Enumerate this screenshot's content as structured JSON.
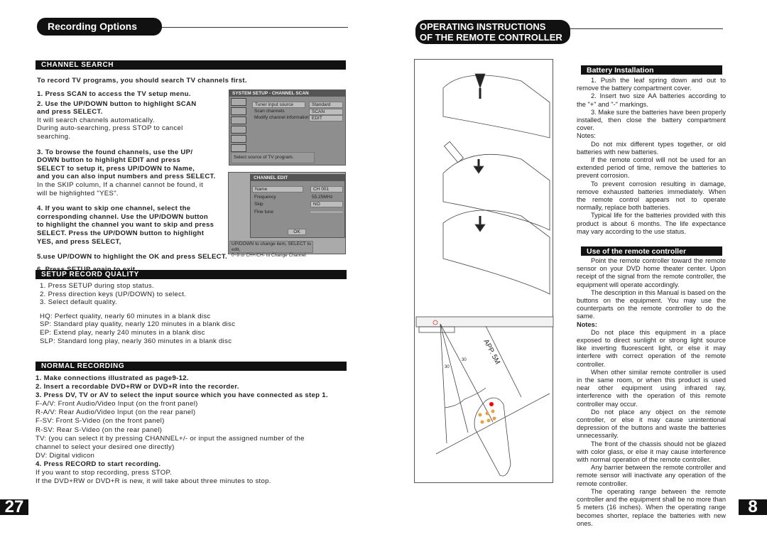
{
  "left": {
    "header": "Recording Options",
    "page_number": "27",
    "channel_search": {
      "title": "CHANNEL SEARCH",
      "intro": "To record TV programs, you should search TV channels first.",
      "lines": [
        {
          "text": "1. Press SCAN to access the TV setup menu.",
          "bold": true
        },
        {
          "text": "2. Use the UP/DOWN button to highlight SCAN",
          "bold": true
        },
        {
          "text": "and press SELECT.",
          "bold": true
        },
        {
          "text": "It will search channels automatically.",
          "bold": false
        },
        {
          "text": "During auto-searching, press STOP to cancel",
          "bold": false
        },
        {
          "text": "searching.",
          "bold": false
        },
        {
          "text": "3. To browse the found channels, use the UP/",
          "bold": true
        },
        {
          "text": "DOWN  button to highlight EDIT and press",
          "bold": true
        },
        {
          "text": "SELECT to setup it, press UP/DOWN to Name,",
          "bold": true
        },
        {
          "text": "and you can also input numbers and press SELECT.",
          "bold": true
        },
        {
          "text": "In the SKIP column, If a channel cannot be found, it",
          "bold": false
        },
        {
          "text": "will be highlighted \"YES\".",
          "bold": false
        },
        {
          "text": "4. If you want to skip one channel, select the",
          "bold": true
        },
        {
          "text": "corresponding channel.  Use the  UP/DOWN button",
          "bold": true
        },
        {
          "text": "to highlight the channel you want to skip and press",
          "bold": true
        },
        {
          "text": "SELECT. Press the UP/DOWN  button to highlight",
          "bold": true
        },
        {
          "text": "YES, and press SELECT,",
          "bold": true
        },
        {
          "text": "5.use UP/DOWN to highlight the OK and press SELECT.",
          "bold": true
        },
        {
          "text": "6. Press SETUP again to exit.",
          "bold": true
        }
      ],
      "scan_screen": {
        "title": "SYSTEM SETUP - CHANNEL SCAN",
        "rows": [
          {
            "label": "Tuner input source",
            "value": "Standard"
          },
          {
            "label": "Scan channels",
            "value": "SCAN"
          },
          {
            "label": "Modify channel information",
            "value": "EDIT"
          }
        ],
        "hint": "Select source of TV program."
      },
      "edit_screen": {
        "title": "CHANNEL EDIT",
        "name_label": "Name",
        "name_value": "CH 001",
        "freq_label": "Frequency",
        "freq_value": "55.25MHz",
        "skip_label": "Skip",
        "skip_value": "NO",
        "fine_label": "Fine tune",
        "ok": "OK",
        "hint1": "UP/DOWN to change item, SELECT to edit,",
        "hint2": "0~9 or CH+/CH- to Change Channel"
      }
    },
    "record_quality": {
      "title": "SETUP RECORD QUALITY",
      "lines": [
        "1. Press SETUP during stop status.",
        "2. Press direction keys (UP/DOWN) to select.",
        "3. Select default quality."
      ],
      "modes": [
        "HQ: Perfect quality, nearly 60 minutes in a blank disc",
        "SP: Standard play quality, nearly 120 minutes in a blank disc",
        "EP: Extend play, nearly 240 minutes in a blank disc",
        "SLP: Standard long play, nearly 360 minutes in a blank disc"
      ]
    },
    "normal_recording": {
      "title": "NORMAL RECORDING",
      "lines": [
        {
          "text": "1. Make connections illustrated as page9-12.",
          "bold": true
        },
        {
          "text": "2. Insert a recordable DVD+RW or DVD+R into the recorder.",
          "bold": true
        },
        {
          "text": "3. Press DV, TV or AV  to select the input source which you have connected as step 1.",
          "bold": true
        },
        {
          "text": "F-A/V: Front Audio/Video Input (on the front panel)",
          "bold": false
        },
        {
          "text": "R-A/V: Rear Audio/Video Input (on the rear panel)",
          "bold": false
        },
        {
          "text": "F-SV: Front S-Video (on the front panel)",
          "bold": false
        },
        {
          "text": "R-SV: Rear S-Video (on the rear panel)",
          "bold": false
        },
        {
          "text": "TV: (you can select it by pressing CHANNEL+/- or input the assigned number of the",
          "bold": false
        },
        {
          "text": "channel to select your desired one directly)",
          "bold": false
        },
        {
          "text": "DV: Digital vidicon",
          "bold": false
        },
        {
          "text": "4. Press RECORD to start recording.",
          "bold": true
        },
        {
          "text": "If you want to stop recording, press STOP.",
          "bold": false
        },
        {
          "text": "If the DVD+RW or DVD+R is new, it will take about three minutes to stop.",
          "bold": false
        }
      ]
    }
  },
  "right": {
    "header_line1": "OPERATING INSTRUCTIONS",
    "header_line2": "OF THE REMOTE CONTROLLER",
    "page_number": "8",
    "illustration": {
      "range_label": "APP. 5M",
      "angle1": "30",
      "angle2": "30"
    },
    "battery": {
      "title": "Battery Installation",
      "paras": [
        "1. Push  the leaf spring down and  out to remove the battery compartment cover.",
        "2. Insert two size AA batteries according to the \"+\" and \"-\" markings.",
        "3. Make sure the batteries have been properly installed, then close the battery compartment cover."
      ],
      "notes_label": "Notes:",
      "notes": [
        "Do not mix different types together, or old batteries with new batteries.",
        "If the remote control  will not be used for an extended period of time, remove the batteries to prevent corrosion.",
        "To prevent corrosion resulting in damage, remove exhausted batteries immediately. When the remote control appears not to operate normally, replace both batteries.",
        "Typical life for the batteries provided with this product is about 6 months. The life expectance may vary according to the use status."
      ]
    },
    "use": {
      "title": "Use of the remote controller",
      "paras": [
        "Point the remote controller toward the remote sensor on your DVD home theater center. Upon receipt of the signal from the remote controller, the equipment will operate accordingly.",
        "The description in this Manual is based on the buttons on the equipment. You may use the counterparts on the remote controller to do the same."
      ],
      "notes_label": "Notes:",
      "notes": [
        "Do not place this equipment in a place exposed to direct sunlight or strong light source like inverting fluorescent light, or else it may interfere with correct operation of the remote controller.",
        "When other similar remote controller is used in the same room, or when this product is used near other equipment using infrared ray, interference with the operation of this remote controller may occur.",
        "Do not place any object on the remote controller, or else it may cause unintentional depression of the buttons and waste the batteries unnecessarily.",
        "The front of the chassis should not be glazed with color glass, or else it may cause interference with normal operation of the remote controller.",
        "Any barrier between the remote controller and remote sensor will inactivate any operation of the remote controller.",
        "The operating range between the remote controller and the equipment shall be no more than 5 meters (16 inches). When the operating range becomes shorter, replace the batteries with new ones."
      ]
    }
  }
}
